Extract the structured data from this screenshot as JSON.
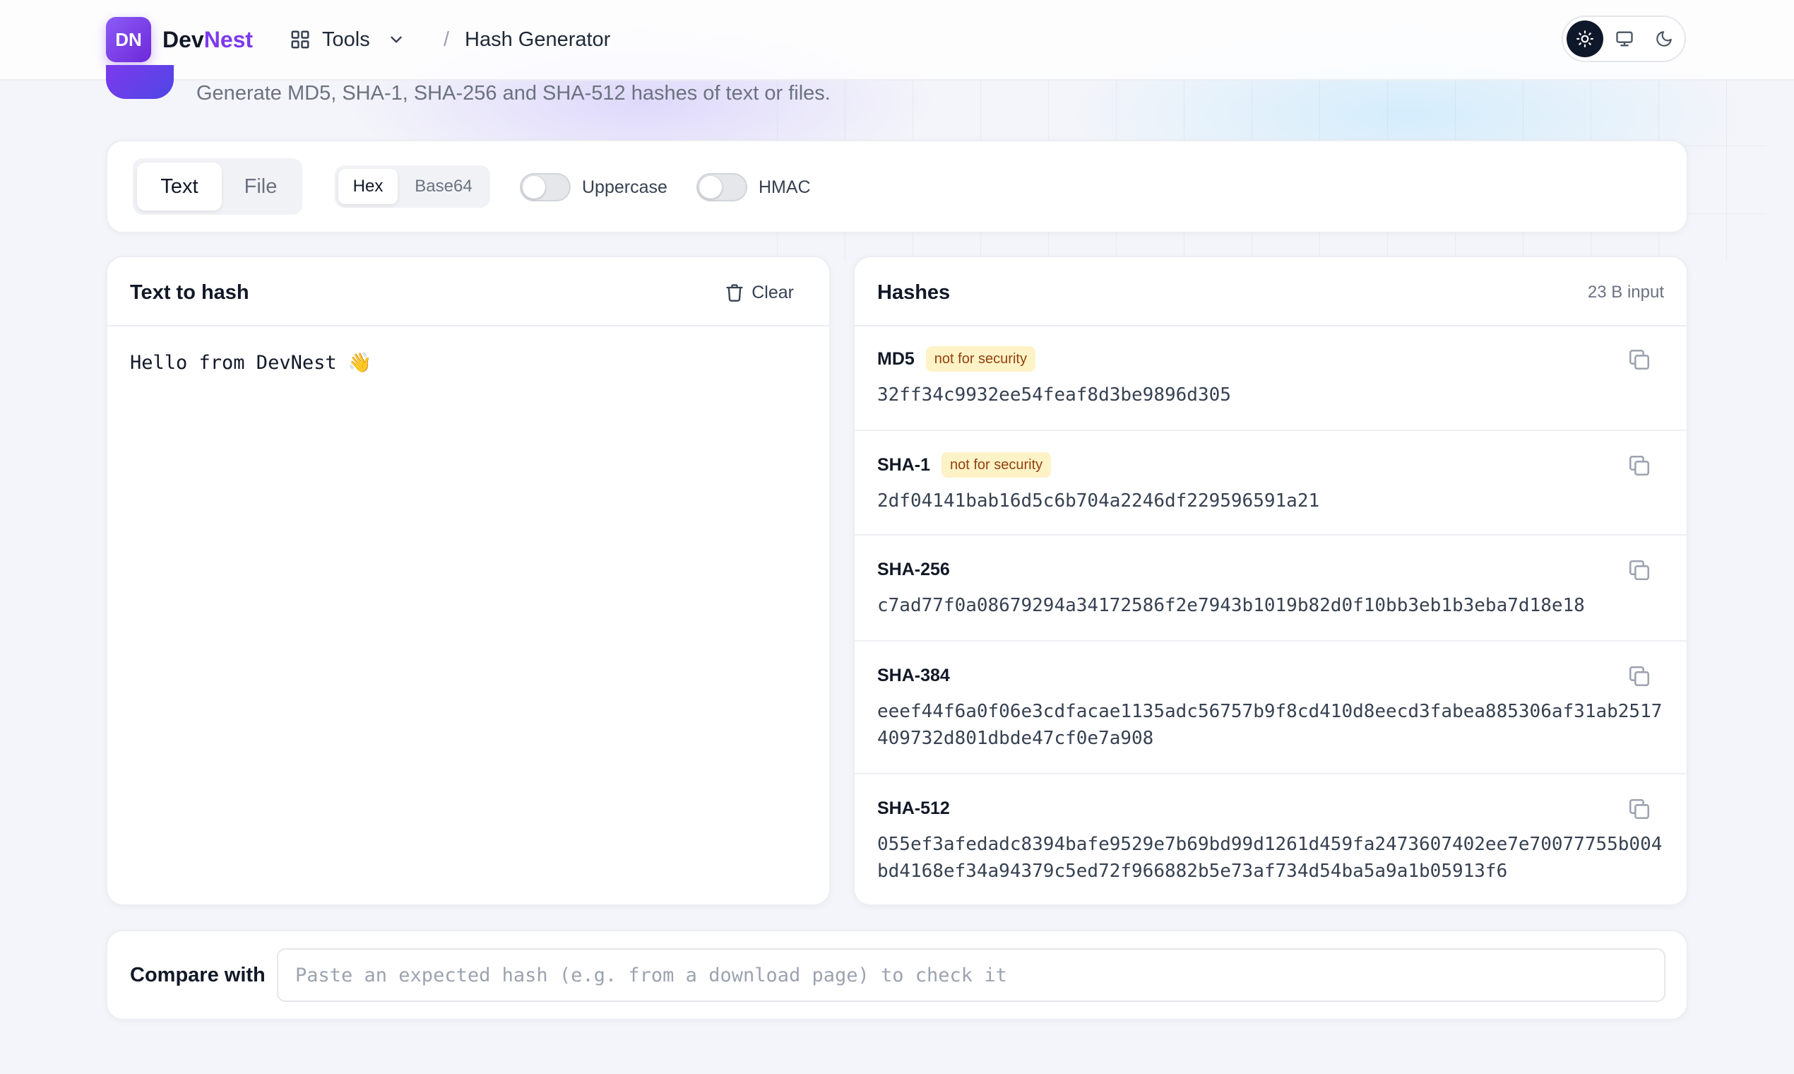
{
  "header": {
    "logo_badge": "DN",
    "brand_part1": "Dev",
    "brand_part2": "Nest",
    "tools_label": "Tools",
    "separator": "/",
    "breadcrumb_current": "Hash Generator",
    "theme_modes": [
      "light",
      "system",
      "dark"
    ],
    "theme_active": "light"
  },
  "intro": {
    "subtitle": "Generate MD5, SHA-1, SHA-256 and SHA-512 hashes of text or files."
  },
  "options": {
    "input_tabs": [
      "Text",
      "File"
    ],
    "input_tab_active": "Text",
    "encodings": [
      "Hex",
      "Base64"
    ],
    "encoding_active": "Hex",
    "uppercase_label": "Uppercase",
    "uppercase_on": false,
    "hmac_label": "HMAC",
    "hmac_on": false
  },
  "input": {
    "title": "Text to hash",
    "clear_label": "Clear",
    "value": "Hello from DevNest 👋"
  },
  "output": {
    "title": "Hashes",
    "input_size": "23 B input",
    "hashes": [
      {
        "name": "MD5",
        "badge": "not for security",
        "value": "32ff34c9932ee54feaf8d3be9896d305"
      },
      {
        "name": "SHA-1",
        "badge": "not for security",
        "value": "2df04141bab16d5c6b704a2246df229596591a21"
      },
      {
        "name": "SHA-256",
        "badge": "",
        "value": "c7ad77f0a08679294a34172586f2e7943b1019b82d0f10bb3eb1b3eba7d18e18"
      },
      {
        "name": "SHA-384",
        "badge": "",
        "value": "eeef44f6a0f06e3cdfacae1135adc56757b9f8cd410d8eecd3fabea885306af31ab2517409732d801dbde47cf0e7a908"
      },
      {
        "name": "SHA-512",
        "badge": "",
        "value": "055ef3afedadc8394bafe9529e7b69bd99d1261d459fa2473607402ee7e70077755b004bd4168ef34a94379c5ed72f966882b5e73af734d54ba5a9a1b05913f6"
      }
    ]
  },
  "compare": {
    "label": "Compare with",
    "placeholder": "Paste an expected hash (e.g. from a download page) to check it",
    "value": ""
  },
  "colors": {
    "accent": "#7c3aed",
    "warning_bg": "#fef3c7",
    "warning_text": "#92400e",
    "dark": "#0f172a"
  }
}
